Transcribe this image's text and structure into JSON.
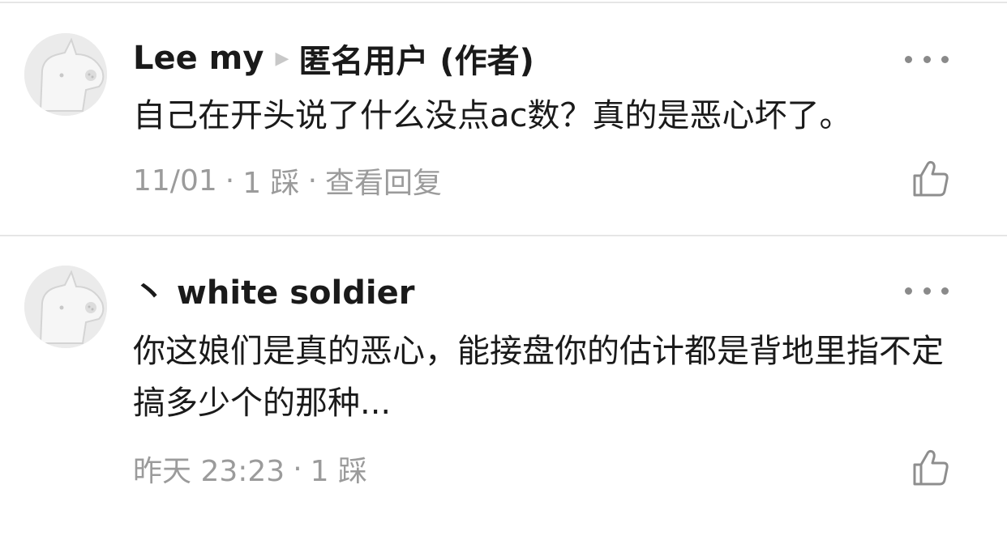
{
  "comments": [
    {
      "author": "Lee my",
      "reply_icon": "triangle-right-icon",
      "reply_to": "匿名用户 (作者)",
      "text": "自己在开头说了什么没点ac数？真的是恶心坏了。",
      "date": "11/01",
      "sep1": "·",
      "dislikes": "1 踩",
      "sep2": "·",
      "view_replies": "查看回复"
    },
    {
      "author": "丶 white soldier",
      "text": "你这娘们是真的恶心，能接盘你的估计都是背地里指不定搞多少个的那种...",
      "date": "昨天 23:23",
      "sep1": "·",
      "dislikes": "1 踩"
    }
  ],
  "colors": {
    "text_primary": "#1a1a1a",
    "text_secondary": "#9b9b9b",
    "divider": "#e6e6e6",
    "avatar_bg": "#ebebeb"
  }
}
